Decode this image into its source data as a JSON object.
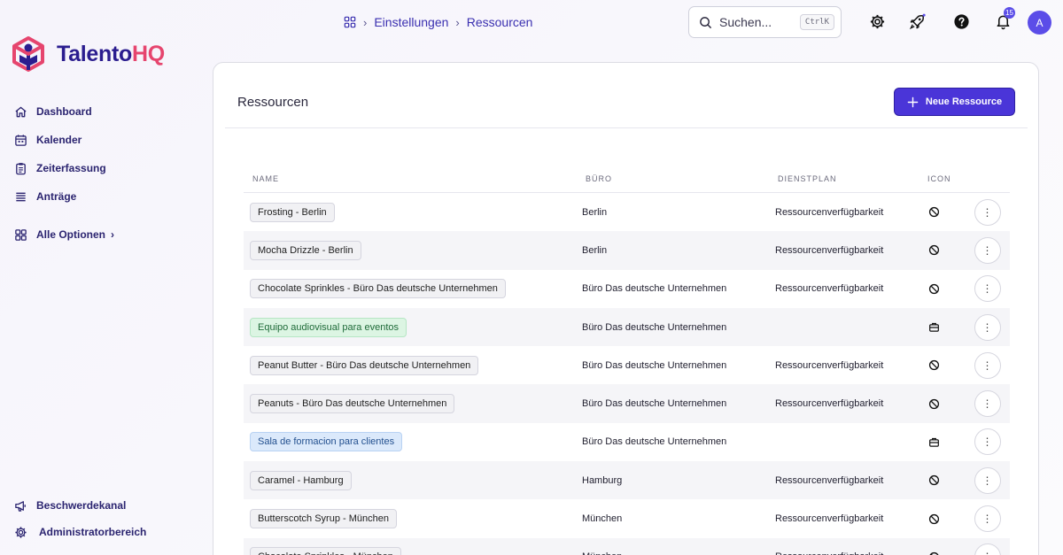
{
  "brand": {
    "name_main": "Talento",
    "name_accent": "HQ",
    "primary": "#2b1d8f",
    "accent": "#e6456e"
  },
  "sidebar": {
    "items": [
      {
        "label": "Dashboard",
        "icon": "home-icon"
      },
      {
        "label": "Kalender",
        "icon": "calendar-icon"
      },
      {
        "label": "Zeiterfassung",
        "icon": "clipboard-icon"
      },
      {
        "label": "Anträge",
        "icon": "list-icon"
      }
    ],
    "all_options": {
      "label": "Alle Optionen",
      "icon": "grid-icon"
    },
    "bottom": [
      {
        "label": "Beschwerdekanal",
        "icon": "megaphone-icon"
      },
      {
        "label": "Administratorbereich",
        "icon": "gear-icon"
      }
    ]
  },
  "header": {
    "breadcrumb": [
      "Einstellungen",
      "Ressourcen"
    ],
    "search": {
      "placeholder": "Suchen...",
      "shortcut": "CtrlK"
    },
    "notifications_count": "15",
    "avatar_initial": "A"
  },
  "main": {
    "title": "Ressourcen",
    "new_button": "Neue Ressource",
    "columns": [
      "NAME",
      "BÜRO",
      "DIENSTPLAN",
      "ICON"
    ],
    "rows": [
      {
        "name": "Frosting - Berlin",
        "office": "Berlin",
        "schedule": "Ressourcenverfügbarkeit",
        "icon": "ban-icon",
        "tag": "gray"
      },
      {
        "name": "Mocha Drizzle - Berlin",
        "office": "Berlin",
        "schedule": "Ressourcenverfügbarkeit",
        "icon": "ban-icon",
        "tag": "gray"
      },
      {
        "name": "Chocolate Sprinkles - Büro Das deutsche Unternehmen",
        "office": "Büro Das deutsche Unternehmen",
        "schedule": "Ressourcenverfügbarkeit",
        "icon": "ban-icon",
        "tag": "gray"
      },
      {
        "name": "Equipo audiovisual para eventos",
        "office": "Büro Das deutsche Unternehmen",
        "schedule": "",
        "icon": "briefcase-icon",
        "tag": "green"
      },
      {
        "name": "Peanut Butter - Büro Das deutsche Unternehmen",
        "office": "Büro Das deutsche Unternehmen",
        "schedule": "Ressourcenverfügbarkeit",
        "icon": "ban-icon",
        "tag": "gray"
      },
      {
        "name": "Peanuts - Büro Das deutsche Unternehmen",
        "office": "Büro Das deutsche Unternehmen",
        "schedule": "Ressourcenverfügbarkeit",
        "icon": "ban-icon",
        "tag": "gray"
      },
      {
        "name": "Sala de formacion para clientes",
        "office": "Büro Das deutsche Unternehmen",
        "schedule": "",
        "icon": "briefcase-icon",
        "tag": "blue"
      },
      {
        "name": "Caramel - Hamburg",
        "office": "Hamburg",
        "schedule": "Ressourcenverfügbarkeit",
        "icon": "ban-icon",
        "tag": "gray"
      },
      {
        "name": "Butterscotch Syrup - München",
        "office": "München",
        "schedule": "Ressourcenverfügbarkeit",
        "icon": "ban-icon",
        "tag": "gray"
      },
      {
        "name": "Chocolate Sprinkles - München",
        "office": "München",
        "schedule": "Ressourcenverfügbarkeit",
        "icon": "ban-icon",
        "tag": "gray"
      }
    ],
    "row_menu_glyph": "⋮"
  }
}
